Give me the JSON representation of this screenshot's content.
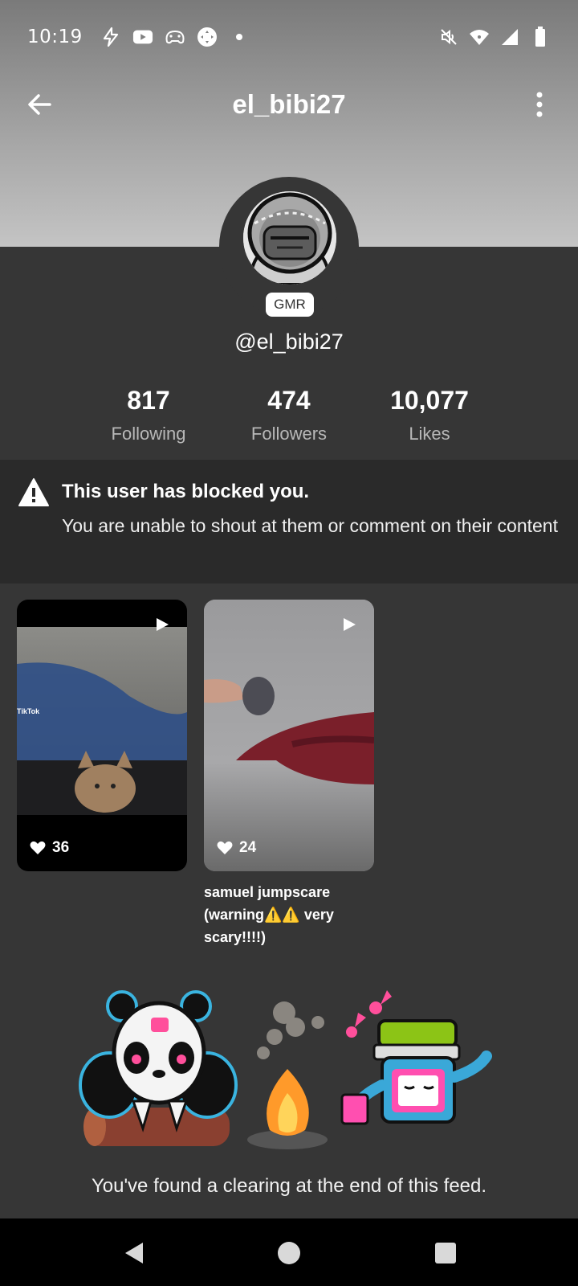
{
  "status_bar": {
    "time": "10:19",
    "left_icons": [
      "bolt-icon",
      "youtube-icon",
      "game-controller-icon",
      "gamepad-icon",
      "dot-icon"
    ],
    "right_icons": [
      "mute-icon",
      "wifi-icon",
      "signal-icon",
      "battery-icon"
    ]
  },
  "header": {
    "title": "el_bibi27",
    "back_icon": "arrow-left-icon",
    "more_icon": "more-vertical-icon"
  },
  "profile": {
    "badge": "GMR",
    "handle": "@el_bibi27",
    "stats": [
      {
        "value": "817",
        "label": "Following"
      },
      {
        "value": "474",
        "label": "Followers"
      },
      {
        "value": "10,077",
        "label": "Likes"
      }
    ]
  },
  "blocked": {
    "title": "This user has blocked you.",
    "message": "You are unable to shout at them or comment on their content"
  },
  "videos": [
    {
      "likes": "36",
      "caption": "",
      "overlay_text": "TikTok"
    },
    {
      "likes": "24",
      "caption": "samuel jumpscare (warning⚠️⚠️ very scary!!!!)"
    }
  ],
  "feed_end": {
    "text": "You've found a clearing at the end of this feed."
  },
  "colors": {
    "background": "#363636",
    "banner": "#2a2a2a",
    "header_top": "#7a7a7a",
    "header_bottom": "#c4c4c4"
  }
}
